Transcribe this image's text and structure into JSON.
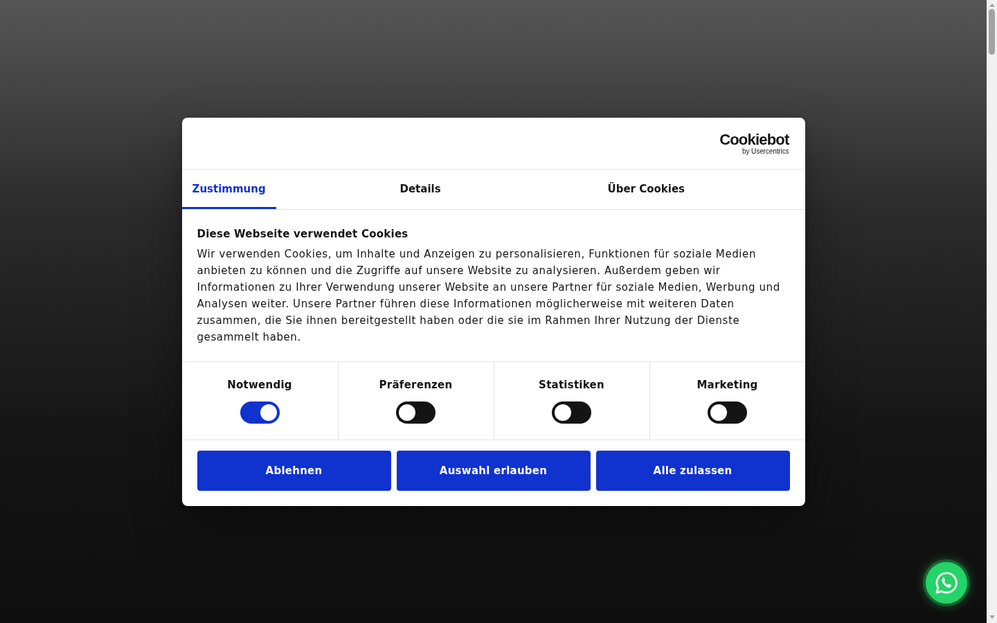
{
  "header": {
    "logo": {
      "name": "Cookiebot",
      "tagline": "by Usercentrics"
    }
  },
  "tabs": [
    {
      "label": "Zustimmung",
      "selected": true
    },
    {
      "label": "Details",
      "selected": false
    },
    {
      "label": "Über Cookies",
      "selected": false
    }
  ],
  "consent": {
    "title": "Diese Webseite verwendet Cookies",
    "text": "Wir verwenden Cookies, um Inhalte und Anzeigen zu personalisieren, Funktionen für soziale Medien anbieten zu können und die Zugriffe auf unsere Website zu analysieren. Außerdem geben wir Informationen zu Ihrer Verwendung unserer Website an unsere Partner für soziale Medien, Werbung und Analysen weiter. Unsere Partner führen diese Informationen möglicherweise mit weiteren Daten zusammen, die Sie ihnen bereitgestellt haben oder die sie im Rahmen Ihrer Nutzung der Dienste gesammelt haben."
  },
  "categories": [
    {
      "label": "Notwendig",
      "on": true
    },
    {
      "label": "Präferenzen",
      "on": false
    },
    {
      "label": "Statistiken",
      "on": false
    },
    {
      "label": "Marketing",
      "on": false
    }
  ],
  "buttons": [
    "Ablehnen",
    "Auswahl erlauben",
    "Alle zulassen"
  ]
}
